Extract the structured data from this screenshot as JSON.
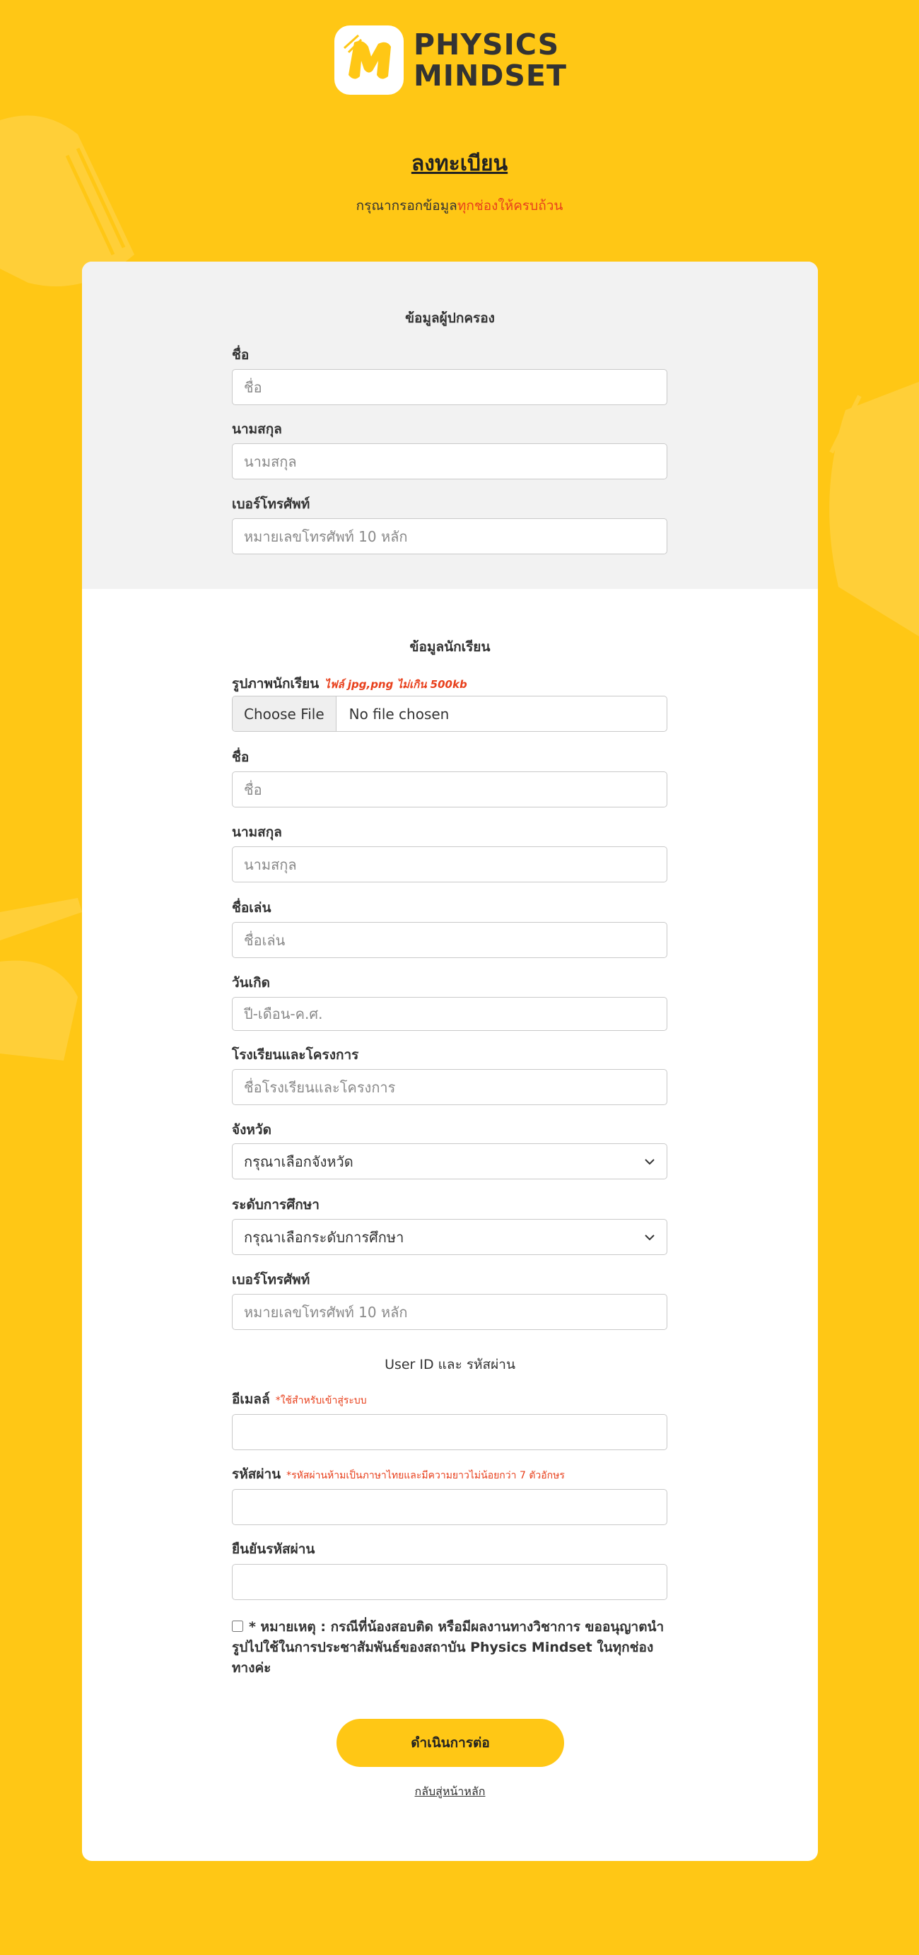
{
  "brand": {
    "line1": "PHYSICS",
    "line2": "MINDSET"
  },
  "page": {
    "title": "ลงทะเบียน",
    "subtitle_prefix": "กรุณากรอกข้อมูล",
    "subtitle_highlight": "ทุกช่องให้ครบถ้วน"
  },
  "parent_section": {
    "title": "ข้อมูลผู้ปกครอง",
    "first_name_label": "ชื่อ",
    "first_name_placeholder": "ชื่อ",
    "last_name_label": "นามสกุล",
    "last_name_placeholder": "นามสกุล",
    "phone_label": "เบอร์โทรศัพท์",
    "phone_placeholder": "หมายเลขโทรศัพท์ 10 หลัก"
  },
  "student_section": {
    "title": "ข้อมูลนักเรียน",
    "photo_label": "รูปภาพนักเรียน",
    "photo_note": "ไฟล์ jpg,png ไม่เกิน 500kb",
    "file_button": "Choose File",
    "file_status": "No file chosen",
    "first_name_label": "ชื่อ",
    "first_name_placeholder": "ชื่อ",
    "last_name_label": "นามสกุล",
    "last_name_placeholder": "นามสกุล",
    "nickname_label": "ชื่อเล่น",
    "nickname_placeholder": "ชื่อเล่น",
    "birthday_label": "วันเกิด",
    "birthday_placeholder": "ปี-เดือน-ค.ศ.",
    "school_label": "โรงเรียนและโครงการ",
    "school_placeholder": "ชื่อโรงเรียนและโครงการ",
    "province_label": "จังหวัด",
    "province_value": "กรุณาเลือกจังหวัด",
    "level_label": "ระดับการศึกษา",
    "level_value": "กรุณาเลือกระดับการศึกษา",
    "phone_label": "เบอร์โทรศัพท์",
    "phone_placeholder": "หมายเลขโทรศัพท์ 10 หลัก"
  },
  "account_section": {
    "title": "User ID และ รหัสผ่าน",
    "email_label": "อีเมลล์",
    "email_note": "*ใช้สำหรับเข้าสู่ระบบ",
    "password_label": "รหัสผ่าน",
    "password_note": "*รหัสผ่านห้ามเป็นภาษาไทยและมีความยาวไม่น้อยกว่า 7 ตัวอักษร",
    "confirm_label": "ยืนยันรหัสผ่าน"
  },
  "consent": {
    "text": "* หมายเหตุ : กรณีที่น้องสอบติด หรือมีผลงานทางวิชาการ ขออนุญาตนำรูปไปใช้ในการประชาสัมพันธ์ของสถาบัน Physics Mindset ในทุกช่องทางค่ะ"
  },
  "actions": {
    "submit_label": "ดำเนินการต่อ",
    "back_label": "กลับสู่หน้าหลัก"
  },
  "icons": {
    "select_arrow": "chevron-down-icon",
    "logo": "pm-logo-icon"
  },
  "colors": {
    "background": "#FFC715",
    "accent_text": "#E8401C",
    "card": "#FFFFFF",
    "parent_section_bg": "#F2F2F2"
  }
}
